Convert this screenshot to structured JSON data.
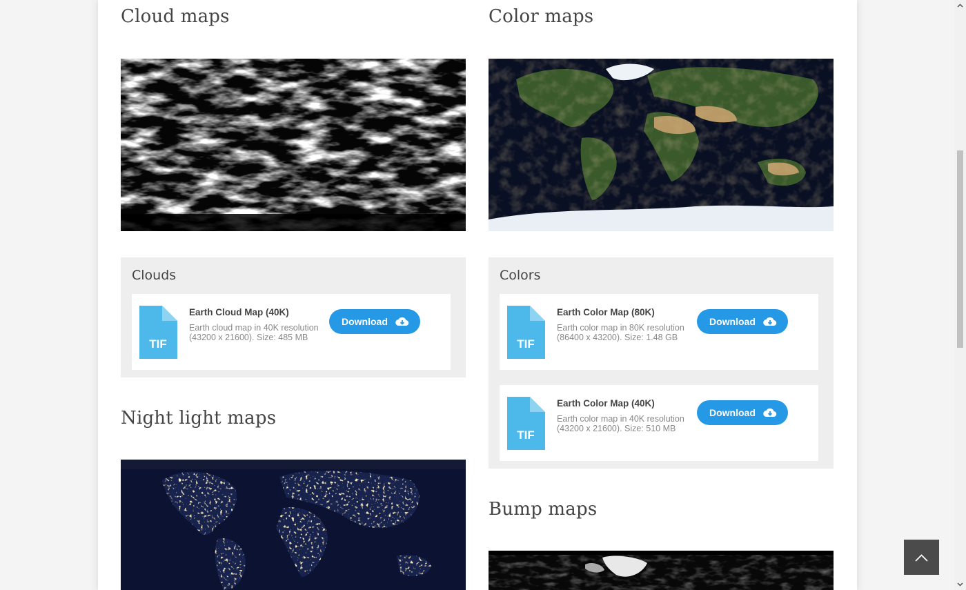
{
  "sections": {
    "cloud_title": "Cloud maps",
    "color_title": "Color maps",
    "night_title": "Night light maps",
    "bump_title": "Bump maps"
  },
  "clouds_panel": {
    "title": "Clouds",
    "files": [
      {
        "name": "Earth Cloud Map (40K)",
        "description": "Earth cloud map in 40K resolution (43200 x 21600). Size: 485 MB",
        "format": "TIF",
        "button_label": "Download",
        "button_icon": "cloud-download-icon"
      }
    ]
  },
  "colors_panel": {
    "title": "Colors",
    "files": [
      {
        "name": "Earth Color Map (80K)",
        "description": "Earth color map in 80K resolution (86400 x 43200). Size: 1.48 GB",
        "format": "TIF",
        "button_label": "Download",
        "button_icon": "cloud-download-icon"
      },
      {
        "name": "Earth Color Map (40K)",
        "description": "Earth color map in 40K resolution (43200 x 21600). Size: 510 MB",
        "format": "TIF",
        "button_label": "Download",
        "button_icon": "cloud-download-icon"
      }
    ]
  },
  "colors": {
    "accent": "#2699e6",
    "file_icon": "#4db8ea",
    "panel_bg": "#eeeeee",
    "to_top_bg": "#4b4b4b"
  },
  "to_top_icon": "chevron-up-icon"
}
